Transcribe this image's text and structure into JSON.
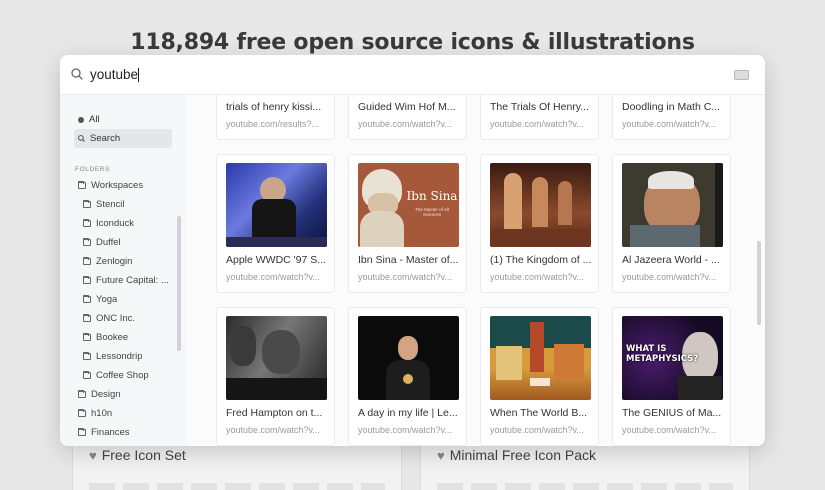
{
  "background": {
    "headline": "118,894 free open source icons & illustrations",
    "cards": [
      {
        "title": "Free Icon Set"
      },
      {
        "title": "Minimal Free Icon Pack"
      }
    ]
  },
  "search": {
    "query": "youtube",
    "icon": "search-icon"
  },
  "sidebar": {
    "top_items": [
      {
        "label": "All",
        "icon": "dot-icon"
      },
      {
        "label": "Search",
        "icon": "search-icon",
        "active": true
      }
    ],
    "folders_heading": "FOLDERS",
    "folders": [
      {
        "label": "Workspaces",
        "level": 0
      },
      {
        "label": "Stencil",
        "level": 1
      },
      {
        "label": "Iconduck",
        "level": 1
      },
      {
        "label": "Duffel",
        "level": 1
      },
      {
        "label": "Zenlogin",
        "level": 1
      },
      {
        "label": "Future Capital: ...",
        "level": 1
      },
      {
        "label": "Yoga",
        "level": 1
      },
      {
        "label": "ONC Inc.",
        "level": 1
      },
      {
        "label": "Bookee",
        "level": 1
      },
      {
        "label": "Lessondrip",
        "level": 1
      },
      {
        "label": "Coffee Shop",
        "level": 1
      },
      {
        "label": "Design",
        "level": 0
      },
      {
        "label": "h10n",
        "level": 0
      },
      {
        "label": "Finances",
        "level": 0
      }
    ]
  },
  "results": [
    {
      "title": "trials of henry kissi...",
      "url": "youtube.com/results?...",
      "thumb": "doc"
    },
    {
      "title": "Guided Wim Hof M...",
      "url": "youtube.com/watch?v...",
      "thumb": "dark-red"
    },
    {
      "title": "The Trials Of Henry...",
      "url": "youtube.com/watch?v...",
      "thumb": "grey"
    },
    {
      "title": "Doodling in Math C...",
      "url": "youtube.com/watch?v...",
      "thumb": "olive"
    },
    {
      "title": "Apple WWDC '97 S...",
      "url": "youtube.com/watch?v...",
      "thumb": "wwdc"
    },
    {
      "title": "Ibn Sina - Master of...",
      "url": "youtube.com/watch?v...",
      "thumb": "ibnsina",
      "overlay_title": "Ibn Sina",
      "overlay_sub": "The Master of All Sciences"
    },
    {
      "title": "(1) The Kingdom of ...",
      "url": "youtube.com/watch?v...",
      "thumb": "arches"
    },
    {
      "title": "Al Jazeera World - ...",
      "url": "youtube.com/watch?v...",
      "thumb": "portrait"
    },
    {
      "title": "Fred Hampton on t...",
      "url": "youtube.com/watch?v...",
      "thumb": "bw"
    },
    {
      "title": "A day in my life | Le...",
      "url": "youtube.com/watch?v...",
      "thumb": "dayinlife"
    },
    {
      "title": "When The World B...",
      "url": "youtube.com/watch?v...",
      "thumb": "painting"
    },
    {
      "title": "The GENIUS of Ma...",
      "url": "youtube.com/watch?v...",
      "thumb": "metaphysics",
      "overlay_title": "WHAT IS METAPHYSICS?"
    }
  ]
}
